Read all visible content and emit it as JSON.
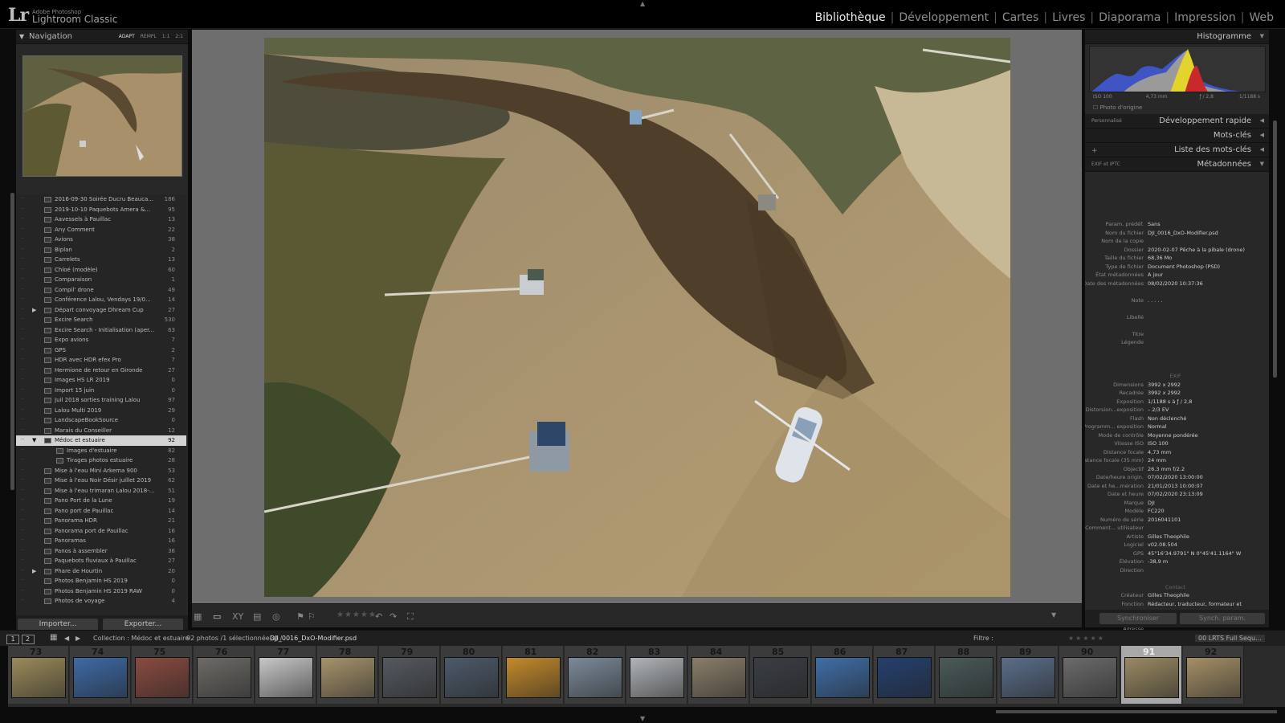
{
  "app": {
    "vendor": "Adobe Photoshop",
    "name": "Lightroom Classic",
    "logo": "Lr"
  },
  "modules": [
    {
      "label": "Bibliothèque",
      "active": true
    },
    {
      "label": "Développement"
    },
    {
      "label": "Cartes"
    },
    {
      "label": "Livres"
    },
    {
      "label": "Diaporama"
    },
    {
      "label": "Impression"
    },
    {
      "label": "Web"
    }
  ],
  "navigator": {
    "title": "Navigation",
    "zoom": [
      "ADAPT",
      "REMPL",
      "1:1",
      "2:1"
    ]
  },
  "collections": [
    {
      "name": "2016-09-30 Soirée Ducru Beauca...",
      "count": "186"
    },
    {
      "name": "2019-10-10 Paquebots Amera &...",
      "count": "95"
    },
    {
      "name": "Aavessels à Pauillac",
      "count": "13"
    },
    {
      "name": "Any Comment",
      "count": "22"
    },
    {
      "name": "Avions",
      "count": "38"
    },
    {
      "name": "Biplan",
      "count": "2"
    },
    {
      "name": "Carrelets",
      "count": "13"
    },
    {
      "name": "Chloé (modèle)",
      "count": "60"
    },
    {
      "name": "Comparaison",
      "count": "1"
    },
    {
      "name": "Compil' drone",
      "count": "49"
    },
    {
      "name": "Conférence Lalou, Vendays 19/0...",
      "count": "14"
    },
    {
      "name": "Départ convoyage Dhream Cup",
      "count": "27"
    },
    {
      "name": "Excire Search",
      "count": "530"
    },
    {
      "name": "Excire Search - Initialisation (aper...",
      "count": "63"
    },
    {
      "name": "Expo avions",
      "count": "7"
    },
    {
      "name": "GPS",
      "count": "2"
    },
    {
      "name": "HDR avec HDR efex Pro",
      "count": "7"
    },
    {
      "name": "Hermione de retour en Gironde",
      "count": "27"
    },
    {
      "name": "Images HS LR 2019",
      "count": "0"
    },
    {
      "name": "Import 15 juin",
      "count": "0"
    },
    {
      "name": "Juil 2018 sorties training Lalou",
      "count": "97"
    },
    {
      "name": "Lalou Multi 2019",
      "count": "29"
    },
    {
      "name": "LandscapeBookSource",
      "count": "0"
    },
    {
      "name": "Marais du Conseiller",
      "count": "12"
    },
    {
      "name": "Médoc et estuaire",
      "count": "92"
    },
    {
      "name": "Images d'estuaire",
      "count": "82"
    },
    {
      "name": "Tirages photos estuaire",
      "count": "28"
    },
    {
      "name": "Mise à l'eau Mini Arkema 900",
      "count": "53"
    },
    {
      "name": "Mise à l'eau Noir Désir juillet 2019",
      "count": "62"
    },
    {
      "name": "Mise à l'eau trimaran Lalou 2018-...",
      "count": "51"
    },
    {
      "name": "Pano Port de la Lune",
      "count": "19"
    },
    {
      "name": "Pano port de Pauillac",
      "count": "14"
    },
    {
      "name": "Panorama HDR",
      "count": "21"
    },
    {
      "name": "Panorama port de Pauillac",
      "count": "16"
    },
    {
      "name": "Panoramas",
      "count": "16"
    },
    {
      "name": "Panos à assembler",
      "count": "36"
    },
    {
      "name": "Paquebots fluviaux à Pauillac",
      "count": "27"
    },
    {
      "name": "Phare de Hourtin",
      "count": "20"
    },
    {
      "name": "Photos Benjamin HS 2019",
      "count": "0"
    },
    {
      "name": "Photos Benjamin HS 2019 RAW",
      "count": "0"
    },
    {
      "name": "Photos de voyage",
      "count": "4"
    }
  ],
  "left_buttons": {
    "import": "Importer...",
    "export": "Exporter..."
  },
  "right_panels": {
    "histogram": "Histogramme",
    "quick_dev": "Développement rapide",
    "quick_dev_preset": "Personnalisé",
    "keywords": "Mots-clés",
    "keyword_list": "Liste des mots-clés",
    "metadata": "Métadonnées",
    "metadata_preset": "EXIF et IPTC",
    "hist_info": {
      "iso": "ISO 100",
      "focal": "4,73 mm",
      "aperture": "ƒ / 2,8",
      "shutter": "1/1188 s"
    },
    "original_photo": "Photo d'origine"
  },
  "metadata_rows": [
    {
      "label": "Param. prédéf.",
      "value": "Sans"
    },
    {
      "label": "Nom du fichier",
      "value": "DJI_0016_DxO-Modifier.psd"
    },
    {
      "label": "Nom de la copie",
      "value": ""
    },
    {
      "label": "Dossier",
      "value": "2020-02-07 Pêche à la pibale (drone)"
    },
    {
      "label": "Taille du fichier",
      "value": "68,36 Mo"
    },
    {
      "label": "Type de fichier",
      "value": "Document Photoshop (PSD)"
    },
    {
      "label": "État métadonnées",
      "value": "A jour"
    },
    {
      "label": "Date des métadonnées",
      "value": "08/02/2020 10:37:36"
    },
    {
      "label": "",
      "value": ""
    },
    {
      "label": "Note",
      "value": ". . . . ."
    },
    {
      "label": "",
      "value": ""
    },
    {
      "label": "Libellé",
      "value": ""
    },
    {
      "label": "",
      "value": ""
    },
    {
      "label": "Titre",
      "value": ""
    },
    {
      "label": "Légende",
      "value": ""
    },
    {
      "label": "",
      "value": ""
    },
    {
      "label": "",
      "value": ""
    },
    {
      "label": "",
      "value": ""
    },
    {
      "label": "",
      "value": "EXIF",
      "section": true
    },
    {
      "label": "Dimensions",
      "value": "3992 x 2992"
    },
    {
      "label": "Recadrée",
      "value": "3992 x 2992"
    },
    {
      "label": "Exposition",
      "value": "1/1188 s à ƒ / 2,8"
    },
    {
      "label": "Distorsion...exposition",
      "value": "– 2/3 EV"
    },
    {
      "label": "Flash",
      "value": "Non déclenché"
    },
    {
      "label": "Programm... exposition",
      "value": "Normal"
    },
    {
      "label": "Mode de contrôle",
      "value": "Moyenne pondérée"
    },
    {
      "label": "Vitesse ISO",
      "value": "ISO 100"
    },
    {
      "label": "Distance focale",
      "value": "4,73 mm"
    },
    {
      "label": "Distance focale (35 mm)",
      "value": "24 mm"
    },
    {
      "label": "Objectif",
      "value": "26.3 mm f/2.2"
    },
    {
      "label": "Date/heure origin.",
      "value": "07/02/2020 13:00:00"
    },
    {
      "label": "Date et he...mération",
      "value": "21/01/2013 10:00:07"
    },
    {
      "label": "Date et heure",
      "value": "07/02/2020 23:13:09"
    },
    {
      "label": "Marque",
      "value": "DJI"
    },
    {
      "label": "Modèle",
      "value": "FC220"
    },
    {
      "label": "Numéro de série",
      "value": "2016041101"
    },
    {
      "label": "Comment... utilisateur",
      "value": ""
    },
    {
      "label": "Artiste",
      "value": "Gilles Theophile"
    },
    {
      "label": "Logiciel",
      "value": "v02.08.504"
    },
    {
      "label": "GPS",
      "value": "45°16'34.9791\" N 0°45'41.1164\" W"
    },
    {
      "label": "Élévation",
      "value": "-38,9 m"
    },
    {
      "label": "Direction",
      "value": ""
    },
    {
      "label": "",
      "value": ""
    },
    {
      "label": "",
      "value": "Contact",
      "section": true
    },
    {
      "label": "Créateur",
      "value": "Gilles Theophile"
    },
    {
      "label": "Fonction",
      "value": "Rédacteur, traducteur, formateur et"
    },
    {
      "label": "",
      "value": "photographe"
    },
    {
      "label": "",
      "value": ""
    },
    {
      "label": "Adresse",
      "value": ""
    },
    {
      "label": "Ville",
      "value": ""
    },
    {
      "label": "Région",
      "value": ""
    },
    {
      "label": "Code postal",
      "value": ""
    },
    {
      "label": "Pays/région",
      "value": "France"
    }
  ],
  "right_buttons": {
    "sync": "Synchroniser",
    "sync_params": "Synch. param."
  },
  "filmbar": {
    "page1": "1",
    "page2": "2",
    "collection": "Collection : Médoc et estuaire",
    "count": "92 photos /1 sélectionnée(s) /",
    "filename": "DJI_0016_DxO-Modifier.psd",
    "filter": "Filtre :",
    "filter_preset": "00 LRTS Full Sequ..."
  },
  "filmstrip": [
    "73",
    "74",
    "75",
    "76",
    "77",
    "78",
    "79",
    "80",
    "81",
    "82",
    "83",
    "84",
    "85",
    "86",
    "87",
    "88",
    "89",
    "90",
    "91",
    "92"
  ],
  "selected_thumb": "91"
}
